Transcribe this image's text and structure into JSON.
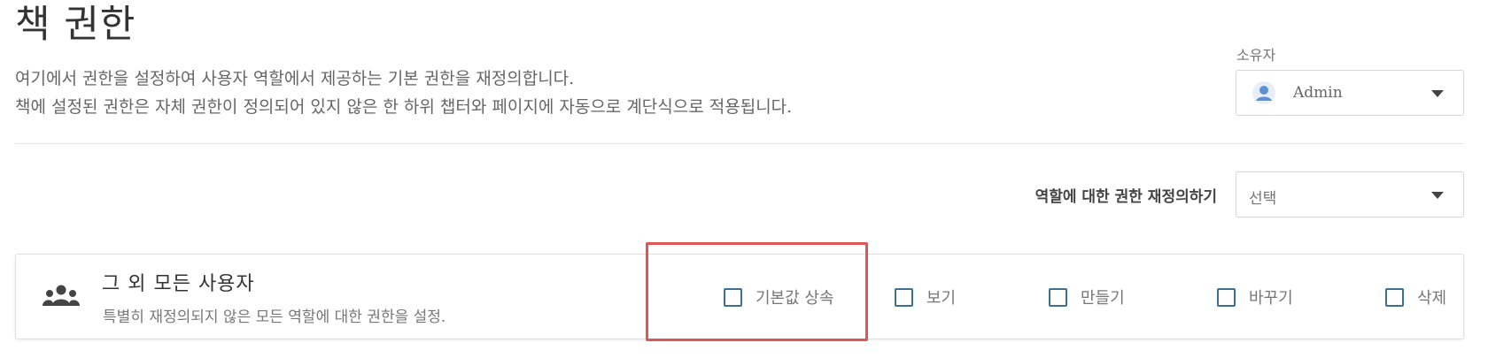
{
  "page": {
    "title": "책 권한",
    "description_line1": "여기에서 권한을 설정하여 사용자 역할에서 제공하는 기본 권한을 재정의합니다.",
    "description_line2": "책에 설정된 권한은 자체 권한이 정의되어 있지 않은 한 하위 챕터와 페이지에 자동으로 계단식으로 적용됩니다."
  },
  "owner": {
    "label": "소유자",
    "value": "Admin",
    "icon": "user-avatar-icon"
  },
  "role_override": {
    "label": "역할에 대한 권한 재정의하기",
    "selected": "선택"
  },
  "entity": {
    "title": "그 외 모든 사용자",
    "description": "특별히 재정의되지 않은 모든 역할에 대한 권한을 설정.",
    "icon": "users-group-icon",
    "permissions": [
      {
        "label": "기본값 상속",
        "checked": false
      },
      {
        "label": "보기",
        "checked": false
      },
      {
        "label": "만들기",
        "checked": false
      },
      {
        "label": "바꾸기",
        "checked": false
      },
      {
        "label": "삭제",
        "checked": false
      }
    ]
  },
  "colors": {
    "accent": "#3d6f93",
    "highlight": "#e05555",
    "avatar": "#5b8fd6"
  }
}
